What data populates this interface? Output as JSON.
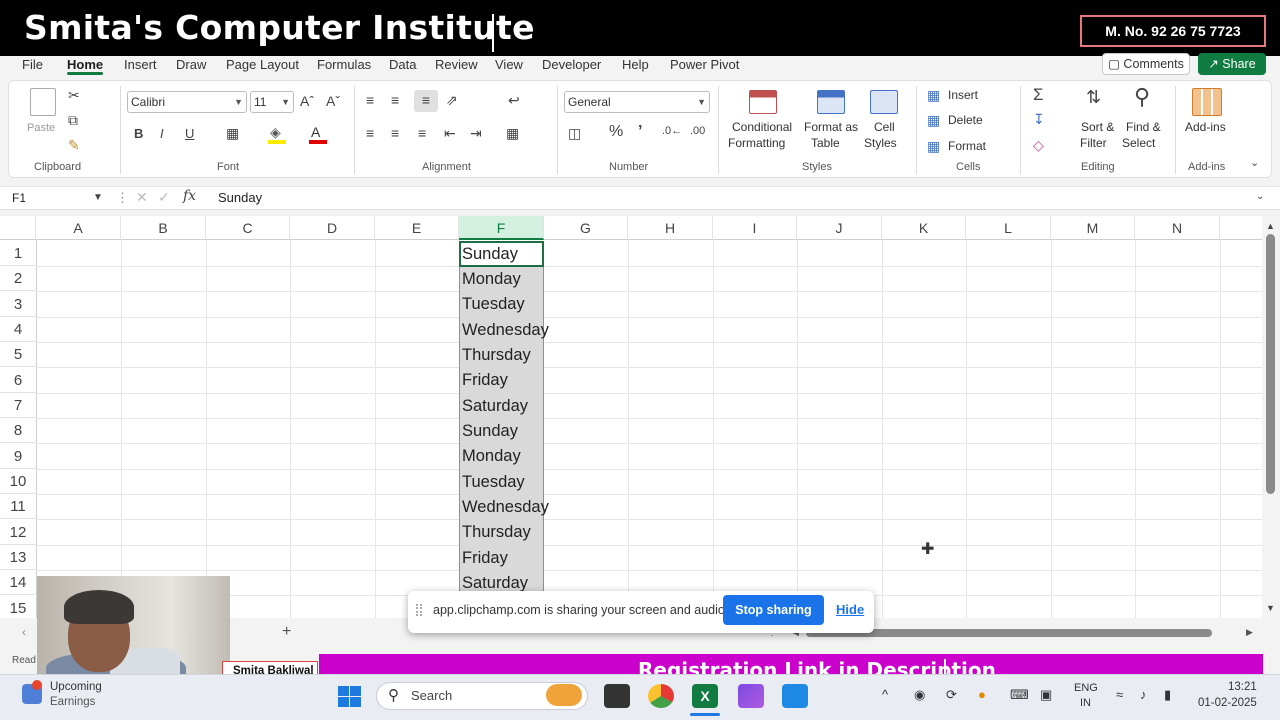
{
  "banner": {
    "title": "Smita's Computer Institute",
    "phone": "M. No. 92 26 75 7723"
  },
  "menu": {
    "tabs": [
      "File",
      "Home",
      "Insert",
      "Draw",
      "Page Layout",
      "Formulas",
      "Data",
      "Review",
      "View",
      "Developer",
      "Help",
      "Power Pivot"
    ],
    "active_tab": "Home",
    "comments_label": "Comments",
    "share_label": "Share"
  },
  "ribbon": {
    "clipboard": {
      "paste": "Paste",
      "label": "Clipboard"
    },
    "font": {
      "name": "Calibri",
      "size": "11",
      "label": "Font"
    },
    "alignment": {
      "label": "Alignment"
    },
    "number": {
      "format": "General",
      "label": "Number"
    },
    "styles": {
      "conditional": "Conditional",
      "formatting": "Formatting",
      "format_as": "Format as",
      "table": "Table",
      "cell": "Cell",
      "styles_btn": "Styles",
      "label": "Styles"
    },
    "cells": {
      "insert": "Insert",
      "delete": "Delete",
      "format": "Format",
      "label": "Cells"
    },
    "editing": {
      "sort": "Sort &",
      "filter": "Filter",
      "find": "Find &",
      "select": "Select",
      "label": "Editing"
    },
    "addins": {
      "btn": "Add-ins",
      "label": "Add-ins"
    }
  },
  "formula_bar": {
    "name_box": "F1",
    "fx": "fx",
    "content": "Sunday"
  },
  "grid": {
    "columns": [
      "A",
      "B",
      "C",
      "D",
      "E",
      "F",
      "G",
      "H",
      "I",
      "J",
      "K",
      "L",
      "M",
      "N"
    ],
    "selected_column": "F",
    "rows": [
      "1",
      "2",
      "3",
      "4",
      "5",
      "6",
      "7",
      "8",
      "9",
      "10",
      "11",
      "12",
      "13",
      "14",
      "15"
    ],
    "f_values": [
      "Sunday",
      "Monday",
      "Tuesday",
      "Wednesday",
      "Thursday",
      "Friday",
      "Saturday",
      "Sunday",
      "Monday",
      "Tuesday",
      "Wednesday",
      "Thursday",
      "Friday",
      "Saturday"
    ]
  },
  "share_notice": {
    "text": "app.clipchamp.com is sharing your screen and audio.",
    "stop": "Stop sharing",
    "hide": "Hide"
  },
  "sheet_bar": {
    "add": "+"
  },
  "status": {
    "ready": "Read"
  },
  "webcam": {
    "name": "Smita Bakliwal"
  },
  "promo": {
    "text": "Registration Link in Description"
  },
  "taskbar": {
    "widget_title": "Upcoming",
    "widget_sub": "Earnings",
    "search": "Search",
    "lang1": "ENG",
    "lang2": "IN",
    "time": "13:21",
    "date": "01-02-2025"
  },
  "colors": {
    "excel_green": "#107c41",
    "banner_bg": "#000000",
    "promo_bg": "#cc00cc",
    "chrome_blue": "#1a73e8"
  }
}
